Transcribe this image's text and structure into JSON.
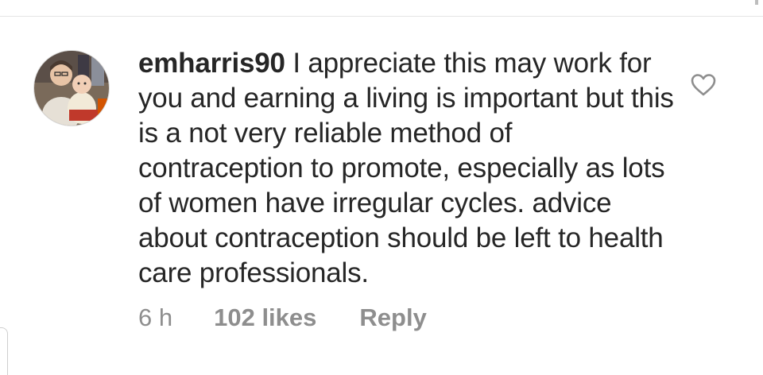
{
  "comment": {
    "username": "emharris90",
    "text": "I appreciate this may work for you and earning a living is important but this is a not very reliable method of contraception to promote, especially as lots of women have irregular cycles. advice about contraception should be left to health care professionals.",
    "time": "6 h",
    "likes": "102 likes",
    "reply_label": "Reply",
    "avatar_icon": "avatar-photo",
    "like_icon": "heart-outline-icon"
  },
  "colors": {
    "text": "#262626",
    "meta": "#8e8e8e",
    "divider": "#e5e5e5"
  }
}
